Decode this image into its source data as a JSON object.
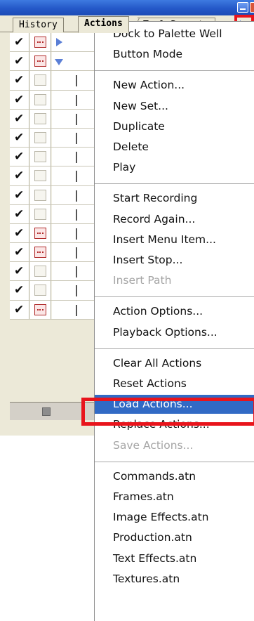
{
  "tabs": {
    "history": "History",
    "actions": "Actions",
    "tool_presets": "Tool Presets"
  },
  "action_rows": [
    {
      "checked": true,
      "dialog_on": true,
      "kind": "set_collapsed"
    },
    {
      "checked": true,
      "dialog_on": true,
      "kind": "set_expanded"
    },
    {
      "checked": true,
      "dialog_on": false,
      "kind": "action"
    },
    {
      "checked": true,
      "dialog_on": false,
      "kind": "action"
    },
    {
      "checked": true,
      "dialog_on": false,
      "kind": "action"
    },
    {
      "checked": true,
      "dialog_on": false,
      "kind": "action"
    },
    {
      "checked": true,
      "dialog_on": false,
      "kind": "action"
    },
    {
      "checked": true,
      "dialog_on": false,
      "kind": "action"
    },
    {
      "checked": true,
      "dialog_on": false,
      "kind": "action"
    },
    {
      "checked": true,
      "dialog_on": false,
      "kind": "action"
    },
    {
      "checked": true,
      "dialog_on": true,
      "kind": "action"
    },
    {
      "checked": true,
      "dialog_on": true,
      "kind": "action"
    },
    {
      "checked": true,
      "dialog_on": false,
      "kind": "action"
    },
    {
      "checked": true,
      "dialog_on": false,
      "kind": "action"
    },
    {
      "checked": true,
      "dialog_on": true,
      "kind": "action"
    }
  ],
  "menu": {
    "group1": [
      {
        "label": "Dock to Palette Well",
        "enabled": true
      },
      {
        "label": "Button Mode",
        "enabled": true
      }
    ],
    "group2": [
      {
        "label": "New Action...",
        "enabled": true
      },
      {
        "label": "New Set...",
        "enabled": true
      },
      {
        "label": "Duplicate",
        "enabled": true
      },
      {
        "label": "Delete",
        "enabled": true
      },
      {
        "label": "Play",
        "enabled": true
      }
    ],
    "group3": [
      {
        "label": "Start Recording",
        "enabled": true
      },
      {
        "label": "Record Again...",
        "enabled": true
      },
      {
        "label": "Insert Menu Item...",
        "enabled": true
      },
      {
        "label": "Insert Stop...",
        "enabled": true
      },
      {
        "label": "Insert Path",
        "enabled": false
      }
    ],
    "group4": [
      {
        "label": "Action Options...",
        "enabled": true
      },
      {
        "label": "Playback Options...",
        "enabled": true
      }
    ],
    "group5": [
      {
        "label": "Clear All Actions",
        "enabled": true
      },
      {
        "label": "Reset Actions",
        "enabled": true
      },
      {
        "label": "Load Actions...",
        "enabled": true,
        "selected": true
      },
      {
        "label": "Replace Actions...",
        "enabled": true
      },
      {
        "label": "Save Actions...",
        "enabled": false
      }
    ],
    "group6": [
      {
        "label": "Commands.atn",
        "enabled": true
      },
      {
        "label": "Frames.atn",
        "enabled": true
      },
      {
        "label": "Image Effects.atn",
        "enabled": true
      },
      {
        "label": "Production.atn",
        "enabled": true
      },
      {
        "label": "Text Effects.atn",
        "enabled": true
      },
      {
        "label": "Textures.atn",
        "enabled": true
      }
    ]
  },
  "colors": {
    "selection": "#316ac5",
    "annotation_red": "#e8141c",
    "title_blue": "#2458c8"
  }
}
